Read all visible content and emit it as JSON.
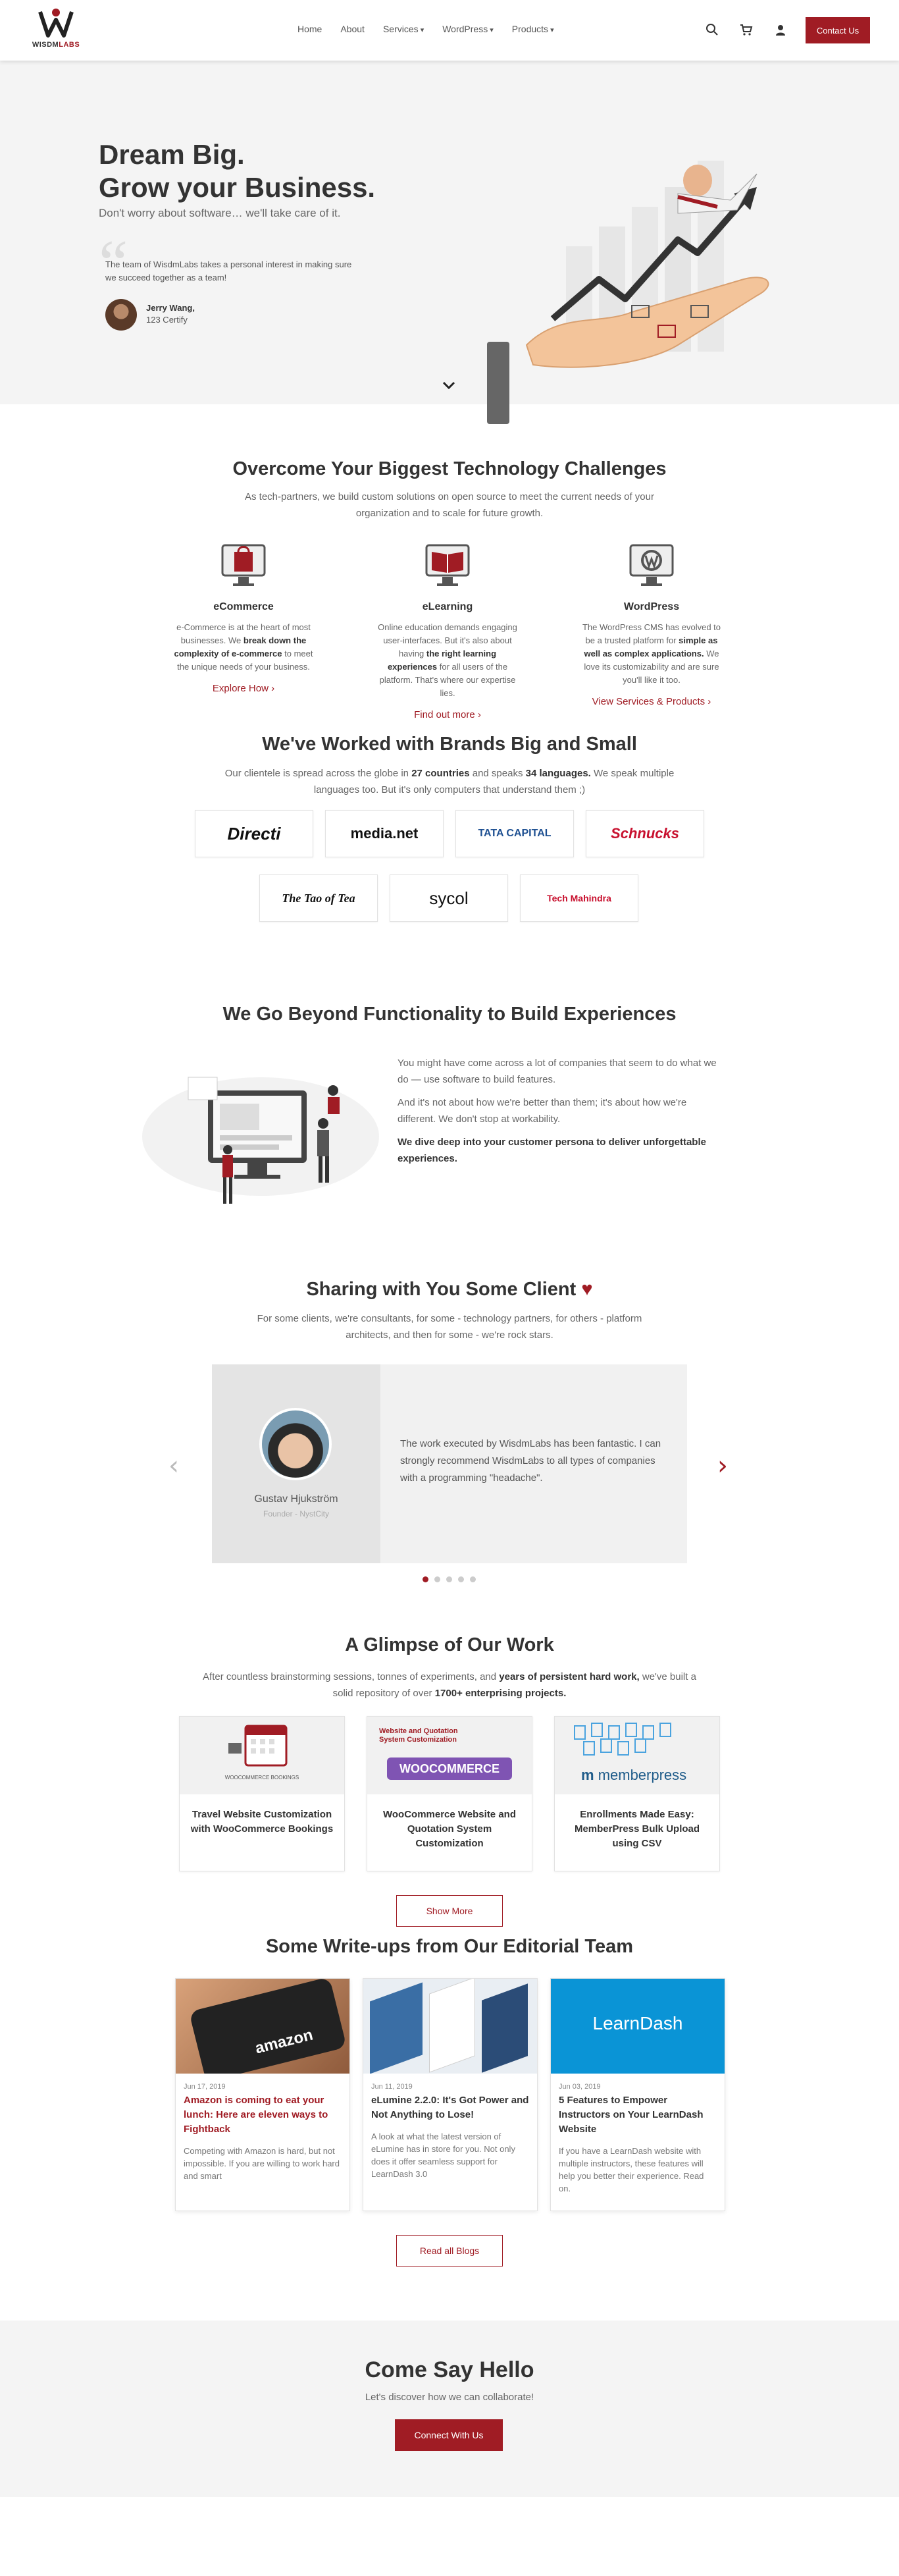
{
  "header": {
    "logo_text": "WISDM",
    "logo_text_accent": "LABS",
    "nav": [
      "Home",
      "About",
      "Services",
      "WordPress",
      "Products"
    ],
    "contact_label": "Contact Us"
  },
  "hero": {
    "title_line1": "Dream Big.",
    "title_line2": "Grow your Business.",
    "subtitle": "Don't worry about software… we'll take care of it.",
    "quote": "The team of WisdmLabs takes a personal interest in making sure we succeed together as a team!",
    "quote_author": "Jerry Wang,",
    "quote_company": "123 Certify"
  },
  "challenges": {
    "title": "Overcome Your Biggest Technology Challenges",
    "subtitle": "As tech-partners, we build custom solutions on open source to meet the current needs of your organization and to scale for future growth.",
    "items": [
      {
        "title": "eCommerce",
        "pre": "e-Commerce is at the heart of most businesses. We ",
        "bold": "break down the complexity of e-commerce",
        "post": " to meet the unique needs of your business.",
        "link": "Explore How"
      },
      {
        "title": "eLearning",
        "pre": "Online education demands engaging user-interfaces. But it's also about having ",
        "bold": "the right learning experiences",
        "post": " for all users of the platform. That's where our expertise lies.",
        "link": "Find out more"
      },
      {
        "title": "WordPress",
        "pre": "The WordPress CMS has evolved to be a trusted platform for ",
        "bold": "simple as well as complex applications.",
        "post": " We love its customizability and are sure you'll like it too.",
        "link": "View Services & Products"
      }
    ]
  },
  "brands": {
    "title": "We've Worked with Brands Big and Small",
    "sub_pre": "Our clientele is spread across the globe in ",
    "sub_bold1": "27 countries",
    "sub_mid": " and speaks ",
    "sub_bold2": "34 languages.",
    "sub_post": " We speak multiple languages too. But it's only computers that understand them ;)",
    "logos": [
      "Directi",
      "media.net",
      "TATA CAPITAL",
      "Schnucks",
      "The Tao of Tea",
      "sycol",
      "Tech Mahindra"
    ]
  },
  "beyond": {
    "title": "We Go Beyond Functionality to Build Experiences",
    "p1": "You might have come across a lot of companies that seem to do what we do — use software to build features.",
    "p2": "And it's not about how we're better than them; it's about how we're different. We don't stop at workability.",
    "p3": "We dive deep into your customer persona to deliver unforgettable experiences."
  },
  "testimonials": {
    "title": "Sharing with You Some Client",
    "heart": "♥",
    "subtitle": "For some clients, we're consultants, for some - technology partners, for others - platform architects, and then for some - we're rock stars.",
    "name": "Gustav Hjukström",
    "role": "Founder - NystCity",
    "quote": "The work executed by WisdmLabs has been fantastic. I can strongly recommend WisdmLabs to all types of companies with a programming \"headache\".",
    "prev": "‹",
    "next": "›"
  },
  "work": {
    "title": "A Glimpse of Our Work",
    "sub_pre": "After countless brainstorming sessions, tonnes of experiments, and ",
    "sub_bold1": "years of persistent hard work,",
    "sub_mid": " we've built a solid repository of over ",
    "sub_bold2": "1700+ enterprising projects.",
    "cards": [
      {
        "title": "Travel Website Customization with WooCommerce Bookings",
        "thumb_label": "WOOCOMMERCE BOOKINGS"
      },
      {
        "title": "WooCommerce Website and Quotation System Customization",
        "thumb_label": "Website and Quotation System Customization",
        "thumb_logo": "WOOCOMMERCE"
      },
      {
        "title": "Enrollments Made Easy: MemberPress Bulk Upload using CSV",
        "thumb_logo": "memberpress"
      }
    ],
    "show_more": "Show More"
  },
  "blog": {
    "title": "Some Write-ups from Our Editorial Team",
    "posts": [
      {
        "date": "Jun 17, 2019",
        "title": "Amazon is coming to eat your lunch: Here are eleven ways to Fightback",
        "excerpt": "Competing with Amazon is hard, but not impossible. If you are willing to work hard and smart",
        "thumb_text": "amazon"
      },
      {
        "date": "Jun 11, 2019",
        "title": "eLumine 2.2.0: It's Got Power and Not Anything to Lose!",
        "excerpt": "A look at what the latest version of eLumine has in store for you. Not only does it offer seamless support for LearnDash 3.0"
      },
      {
        "date": "Jun 03, 2019",
        "title": "5 Features to Empower Instructors on Your LearnDash Website",
        "excerpt": "If you have a LearnDash website with multiple instructors, these features will help you better their experience. Read on.",
        "thumb_text": "LearnDash"
      }
    ],
    "read_all": "Read all Blogs"
  },
  "cta": {
    "title": "Come Say Hello",
    "subtitle": "Let's discover how we can collaborate!",
    "button": "Connect With Us"
  },
  "colors": {
    "brand": "#a01c24",
    "hero_bg": "#f4f4f4",
    "directi": "#c8102e",
    "tata": "#1d4f91",
    "learndash": "#0a94d6"
  }
}
